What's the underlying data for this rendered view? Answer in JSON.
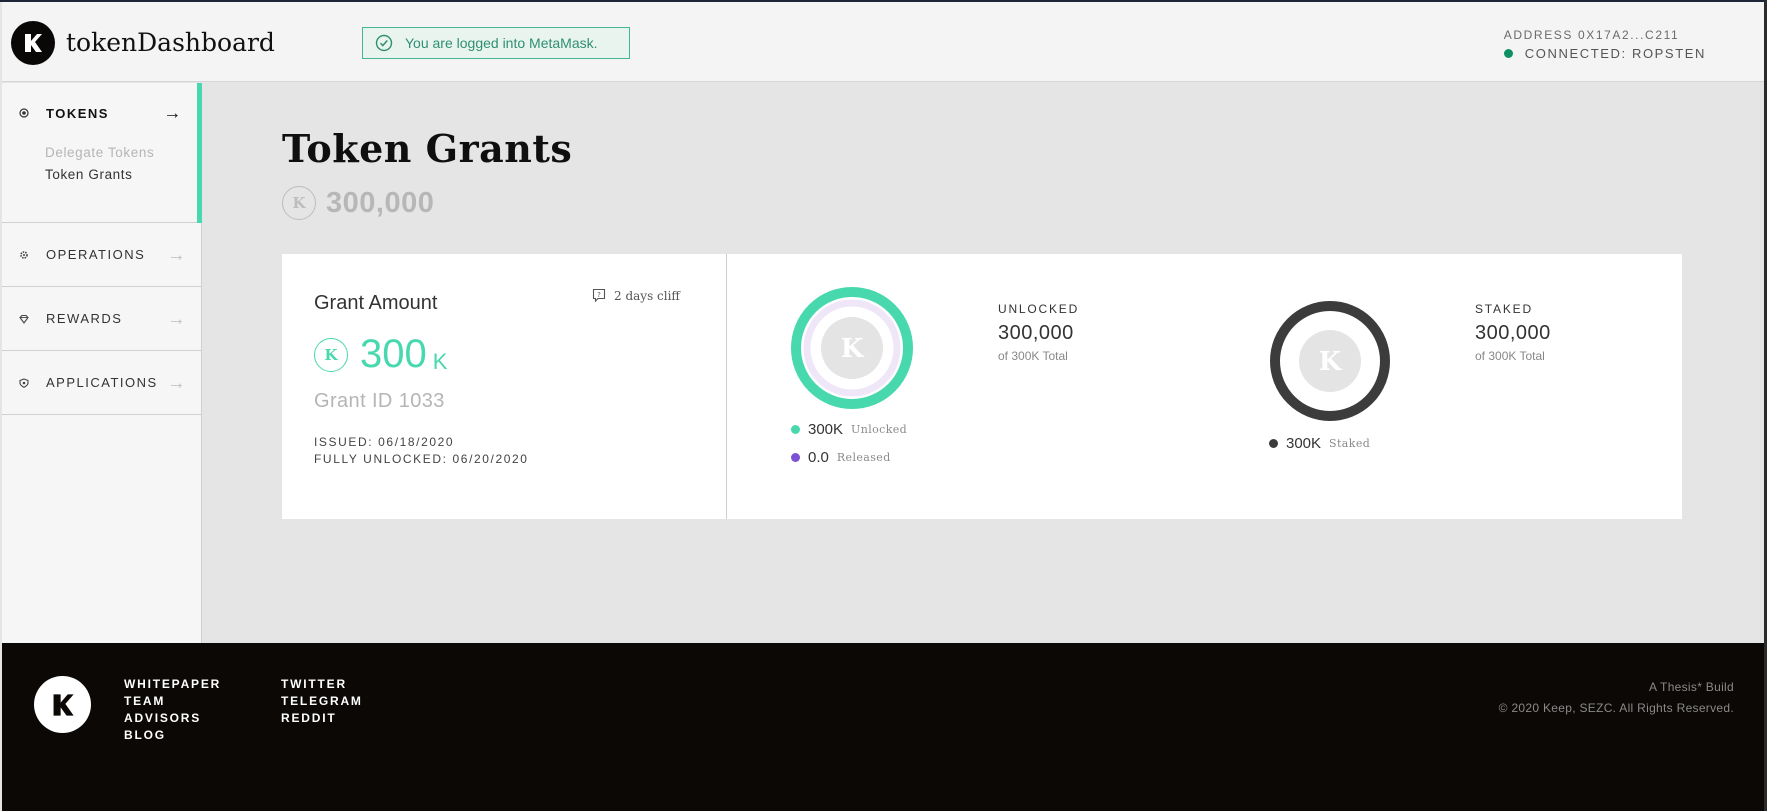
{
  "header": {
    "logo_letter": "K",
    "app_name": "tokenDashboard",
    "notice": "You are logged into MetaMask.",
    "address": "ADDRESS 0X17A2...C211",
    "connection": "CONNECTED: ROPSTEN"
  },
  "sidebar": {
    "tokens": {
      "label": "TOKENS",
      "sub": [
        "Delegate Tokens",
        "Token Grants"
      ]
    },
    "items": [
      {
        "label": "OPERATIONS",
        "icon": "gear-icon"
      },
      {
        "label": "REWARDS",
        "icon": "diamond-icon"
      },
      {
        "label": "APPLICATIONS",
        "icon": "shield-icon"
      }
    ]
  },
  "main": {
    "title": "Token Grants",
    "total": "300,000"
  },
  "grant": {
    "amount_label": "Grant Amount",
    "cliff": "2 days cliff",
    "amount": "300",
    "amount_unit": "K",
    "grant_id": "Grant ID 1033",
    "issued": "ISSUED: 06/18/2020",
    "fully_unlocked": "FULLY UNLOCKED: 06/20/2020"
  },
  "unlocked": {
    "title": "UNLOCKED",
    "value": "300,000",
    "sub": "of 300K Total",
    "legend": [
      {
        "value": "300K",
        "label": "Unlocked",
        "color": "#48d8ae"
      },
      {
        "value": "0.0",
        "label": "Released",
        "color": "#7c52d4"
      }
    ]
  },
  "staked": {
    "title": "STAKED",
    "value": "300,000",
    "sub": "of 300K Total",
    "legend": [
      {
        "value": "300K",
        "label": "Staked",
        "color": "#3c3c3c"
      }
    ]
  },
  "footer": {
    "col1": [
      "WHITEPAPER",
      "TEAM",
      "ADVISORS",
      "BLOG"
    ],
    "col2": [
      "TWITTER",
      "TELEGRAM",
      "REDDIT"
    ],
    "build": "A Thesis* Build",
    "copyright": "© 2020 Keep, SEZC. All Rights Reserved."
  },
  "colors": {
    "accent": "#48d8ae",
    "released": "#7c52d4",
    "staked": "#3c3c3c",
    "connected": "#0b8f64"
  }
}
